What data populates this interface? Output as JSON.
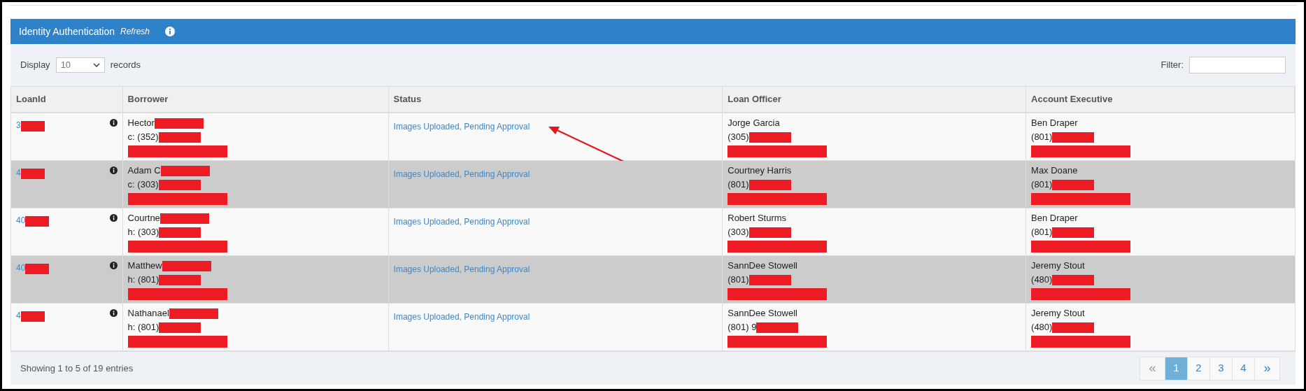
{
  "panel": {
    "title": "Identity Authentication",
    "refresh": "Refresh"
  },
  "toolbar": {
    "display_label": "Display",
    "page_size": "10",
    "records_label": "records",
    "filter_label": "Filter:"
  },
  "table": {
    "columns": [
      "LoanId",
      "Borrower",
      "Status",
      "Loan Officer",
      "Account Executive"
    ],
    "rows": [
      {
        "loan_id": {
          "text": "3",
          "redacted": true
        },
        "arrow": true,
        "borrower": [
          {
            "kind": "text",
            "text": "Hector",
            "redacted": true
          },
          {
            "kind": "text",
            "text": "c: (352)",
            "redacted": true
          },
          {
            "kind": "redacted"
          }
        ],
        "status": "Images Uploaded, Pending Approval",
        "officer": [
          {
            "kind": "text",
            "text": "Jorge Garcia",
            "redacted": false
          },
          {
            "kind": "text",
            "text": "(305)",
            "redacted": true
          },
          {
            "kind": "redacted"
          }
        ],
        "executive": [
          {
            "kind": "text",
            "text": "Ben Draper",
            "redacted": false
          },
          {
            "kind": "text",
            "text": "(801)",
            "redacted": true
          },
          {
            "kind": "redacted"
          }
        ]
      },
      {
        "loan_id": {
          "text": "4",
          "redacted": true
        },
        "arrow": false,
        "borrower": [
          {
            "kind": "text",
            "text": "Adam C",
            "redacted": true
          },
          {
            "kind": "text",
            "text": "c: (303)",
            "redacted": true
          },
          {
            "kind": "redacted"
          }
        ],
        "status": "Images Uploaded, Pending Approval",
        "officer": [
          {
            "kind": "text",
            "text": "Courtney Harris",
            "redacted": false
          },
          {
            "kind": "text",
            "text": "(801)",
            "redacted": true
          },
          {
            "kind": "redacted"
          }
        ],
        "executive": [
          {
            "kind": "text",
            "text": "Max Doane",
            "redacted": false
          },
          {
            "kind": "text",
            "text": "(801)",
            "redacted": true
          },
          {
            "kind": "redacted"
          }
        ]
      },
      {
        "loan_id": {
          "text": "40",
          "redacted": true
        },
        "arrow": false,
        "borrower": [
          {
            "kind": "text",
            "text": "Courtne",
            "redacted": true
          },
          {
            "kind": "text",
            "text": "h: (303)",
            "redacted": true
          },
          {
            "kind": "redacted"
          }
        ],
        "status": "Images Uploaded, Pending Approval",
        "officer": [
          {
            "kind": "text",
            "text": "Robert Sturms",
            "redacted": false
          },
          {
            "kind": "text",
            "text": "(303)",
            "redacted": true
          },
          {
            "kind": "redacted"
          }
        ],
        "executive": [
          {
            "kind": "text",
            "text": "Ben Draper",
            "redacted": false
          },
          {
            "kind": "text",
            "text": "(801)",
            "redacted": true
          },
          {
            "kind": "redacted"
          }
        ]
      },
      {
        "loan_id": {
          "text": "40",
          "redacted": true
        },
        "arrow": false,
        "borrower": [
          {
            "kind": "text",
            "text": "Matthew",
            "redacted": true
          },
          {
            "kind": "text",
            "text": "h: (801)",
            "redacted": true
          },
          {
            "kind": "redacted"
          }
        ],
        "status": "Images Uploaded, Pending Approval",
        "officer": [
          {
            "kind": "text",
            "text": "SannDee Stowell",
            "redacted": false
          },
          {
            "kind": "text",
            "text": "(801)",
            "redacted": true
          },
          {
            "kind": "redacted"
          }
        ],
        "executive": [
          {
            "kind": "text",
            "text": "Jeremy Stout",
            "redacted": false
          },
          {
            "kind": "text",
            "text": "(480)",
            "redacted": true
          },
          {
            "kind": "redacted"
          }
        ]
      },
      {
        "loan_id": {
          "text": "4",
          "redacted": true
        },
        "arrow": false,
        "borrower": [
          {
            "kind": "text",
            "text": "Nathanael",
            "redacted": true
          },
          {
            "kind": "text",
            "text": "h: (801)",
            "redacted": true
          },
          {
            "kind": "redacted"
          }
        ],
        "status": "Images Uploaded, Pending Approval",
        "officer": [
          {
            "kind": "text",
            "text": "SannDee Stowell",
            "redacted": false
          },
          {
            "kind": "text",
            "text": "(801) 9",
            "redacted": true
          },
          {
            "kind": "redacted"
          }
        ],
        "executive": [
          {
            "kind": "text",
            "text": "Jeremy Stout",
            "redacted": false
          },
          {
            "kind": "text",
            "text": "(480)",
            "redacted": true
          },
          {
            "kind": "redacted"
          }
        ]
      }
    ]
  },
  "footer": {
    "info": "Showing 1 to 5 of 19 entries",
    "pagination": [
      {
        "label": "«",
        "kind": "nav",
        "disabled": true,
        "selected": false
      },
      {
        "label": "1",
        "kind": "page",
        "selected": true
      },
      {
        "label": "2",
        "kind": "page",
        "selected": false
      },
      {
        "label": "3",
        "kind": "page",
        "selected": false
      },
      {
        "label": "4",
        "kind": "page",
        "selected": false
      },
      {
        "label": "»",
        "kind": "nav",
        "disabled": false,
        "selected": false
      }
    ]
  }
}
